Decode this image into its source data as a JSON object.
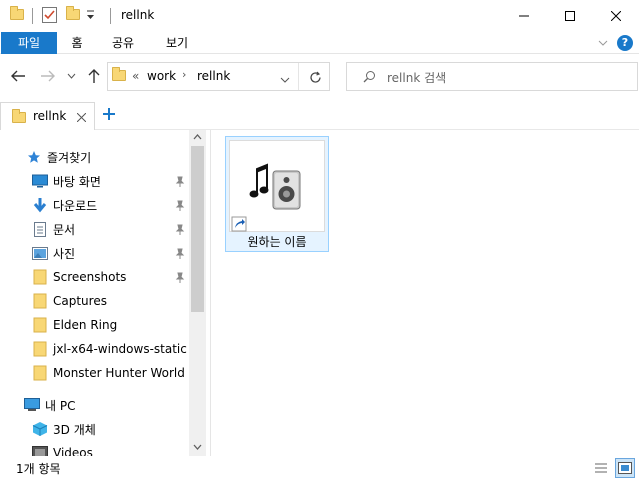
{
  "window": {
    "title": "rellnk"
  },
  "ribbon": {
    "tabs": [
      {
        "label": "파일"
      },
      {
        "label": "홈"
      },
      {
        "label": "공유"
      },
      {
        "label": "보기"
      }
    ]
  },
  "address": {
    "prefix": "«",
    "segments": [
      "work",
      "rellnk"
    ]
  },
  "search": {
    "placeholder": "rellnk 검색"
  },
  "tabs": [
    {
      "label": "rellnk"
    }
  ],
  "sidebar": {
    "quick_access": "즐겨찾기",
    "items": [
      {
        "label": "바탕 화면",
        "icon": "desktop-icon",
        "pinned": true
      },
      {
        "label": "다운로드",
        "icon": "download-icon",
        "pinned": true
      },
      {
        "label": "문서",
        "icon": "document-icon",
        "pinned": true
      },
      {
        "label": "사진",
        "icon": "pictures-icon",
        "pinned": true
      },
      {
        "label": "Screenshots",
        "icon": "folder-icon",
        "pinned": true
      },
      {
        "label": "Captures",
        "icon": "folder-icon",
        "pinned": false
      },
      {
        "label": "Elden Ring",
        "icon": "folder-icon",
        "pinned": false
      },
      {
        "label": "jxl-x64-windows-static",
        "icon": "folder-icon",
        "pinned": false
      },
      {
        "label": "Monster Hunter World",
        "icon": "folder-icon",
        "pinned": false
      }
    ],
    "this_pc": "내 PC",
    "pc_items": [
      {
        "label": "3D 개체",
        "icon": "3d-objects-icon"
      },
      {
        "label": "Videos",
        "icon": "videos-icon"
      }
    ]
  },
  "files": [
    {
      "name": "원하는 이름",
      "icon": "audio-shortcut-icon",
      "selected": true
    }
  ],
  "status": {
    "count": "1개 항목"
  },
  "colors": {
    "accent": "#1979ca",
    "selection_bg": "#e5f3ff",
    "selection_border": "#99d1ff"
  }
}
